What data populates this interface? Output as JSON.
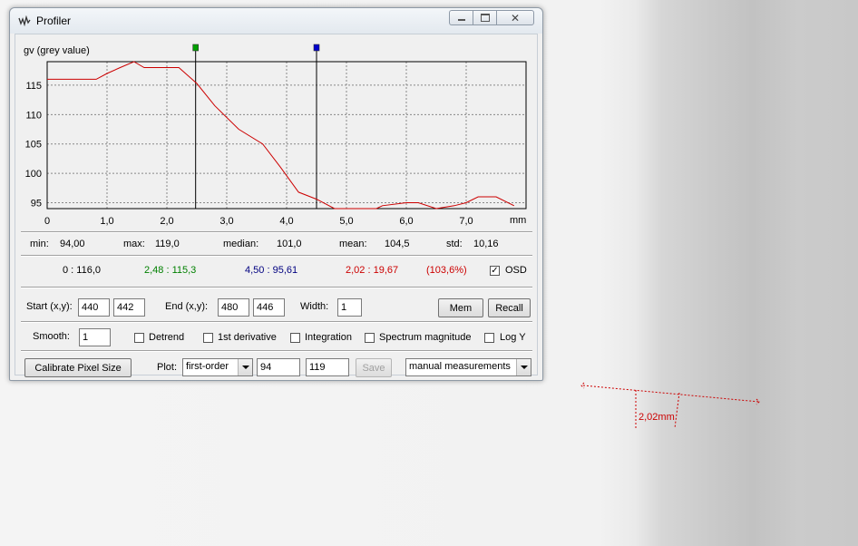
{
  "window": {
    "title": "Profiler",
    "icon": "profile-curve-icon"
  },
  "chart_data": {
    "type": "line",
    "ylabel": "gv (grey value)",
    "x_unit": "mm",
    "xlim": [
      0,
      8
    ],
    "ylim": [
      94,
      119
    ],
    "x_ticks": [
      0,
      1,
      2,
      3,
      4,
      5,
      6,
      7
    ],
    "x_tick_labels": [
      "0",
      "1,0",
      "2,0",
      "3,0",
      "4,0",
      "5,0",
      "6,0",
      "7,0"
    ],
    "y_ticks": [
      95,
      100,
      105,
      110,
      115
    ],
    "y_tick_labels": [
      "95",
      "100",
      "105",
      "110",
      "115"
    ],
    "grid": true,
    "series": [
      {
        "color": "#cc0000",
        "x": [
          0,
          0.82,
          1.0,
          1.22,
          1.45,
          1.62,
          1.8,
          2.2,
          2.5,
          2.8,
          3.2,
          3.6,
          3.9,
          4.2,
          4.5,
          4.8,
          5.2,
          5.5,
          5.6,
          6.0,
          6.2,
          6.5,
          6.8,
          7.0,
          7.2,
          7.5,
          7.8
        ],
        "y": [
          116,
          116,
          117,
          118,
          119,
          118,
          118,
          118,
          115.3,
          111.5,
          107.5,
          105,
          101,
          96.8,
          95.6,
          94,
          94,
          94,
          94.5,
          95,
          95,
          94,
          94.5,
          95,
          96,
          96,
          94.5
        ]
      }
    ],
    "cursors": [
      {
        "x": 2.48,
        "color": "#00a000"
      },
      {
        "x": 4.5,
        "color": "#0000cc"
      }
    ]
  },
  "stats": [
    {
      "label": "min:",
      "value": "94,00"
    },
    {
      "label": "max:",
      "value": "119,0"
    },
    {
      "label": "median:",
      "value": "101,0"
    },
    {
      "label": "mean:",
      "value": "104,5"
    },
    {
      "label": "std:",
      "value": "10,16"
    }
  ],
  "readouts": {
    "origin": "0 : 116,0",
    "cursor1": "2,48 : 115,3",
    "cursor2": "4,50 : 95,61",
    "delta": "2,02 : 19,67",
    "delta_pct": "(103,6%)",
    "osd_label": "OSD",
    "osd_checked": true,
    "colors": {
      "origin": "#000000",
      "cursor1": "#008000",
      "cursor2": "#000080",
      "delta": "#cc0000"
    }
  },
  "coords": {
    "start_label": "Start (x,y):",
    "start_x": "440",
    "start_y": "442",
    "end_label": "End (x,y):",
    "end_x": "480",
    "end_y": "446",
    "width_label": "Width:",
    "width": "1",
    "mem_label": "Mem",
    "recall_label": "Recall"
  },
  "options": {
    "smooth_label": "Smooth:",
    "smooth": "1",
    "checkboxes": [
      {
        "label": "Detrend",
        "checked": false
      },
      {
        "label": "1st derivative",
        "checked": false
      },
      {
        "label": "Integration",
        "checked": false
      },
      {
        "label": "Spectrum magnitude",
        "checked": false
      },
      {
        "label": "Log Y",
        "checked": false
      }
    ]
  },
  "bottom": {
    "calibrate_label": "Calibrate Pixel Size",
    "plot_label": "Plot:",
    "plot_value": "first-order",
    "min_value": "94",
    "max_value": "119",
    "save_label": "Save",
    "mode_value": "manual measurements"
  },
  "measurement": {
    "label": "2,02mm",
    "color": "#cc0000"
  }
}
